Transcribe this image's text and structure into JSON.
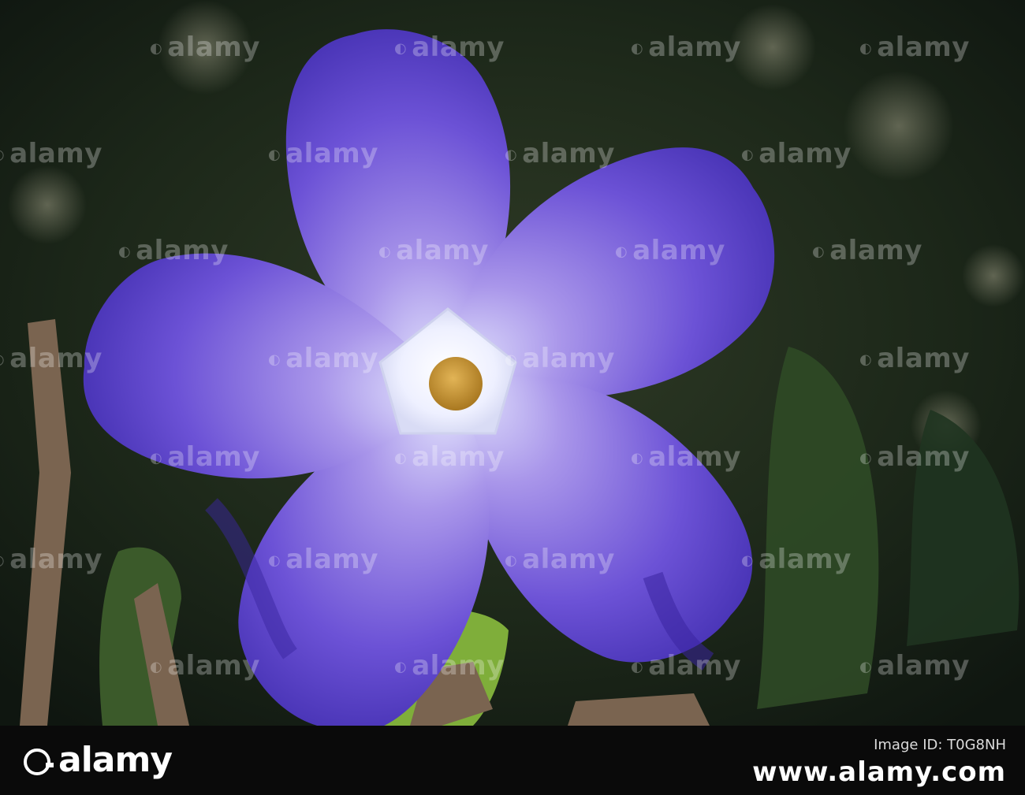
{
  "photo": {
    "subject_icon": "periwinkle-flower",
    "colors": {
      "petal": "#6a4fd6",
      "petal_dark": "#3e2aa8",
      "petal_light": "#c9c2f0",
      "center": "#eef0ff",
      "stamen": "#c8962e",
      "leaf": "#7fae3a",
      "background": "#1a2418"
    }
  },
  "watermark": {
    "text": "alamy",
    "icon": "alamy-logo-icon"
  },
  "footer": {
    "brand": "alamy",
    "brand_icon": "alamy-logo-icon",
    "image_id_label": "Image ID: T0G8NH",
    "site": "www.alamy.com"
  }
}
